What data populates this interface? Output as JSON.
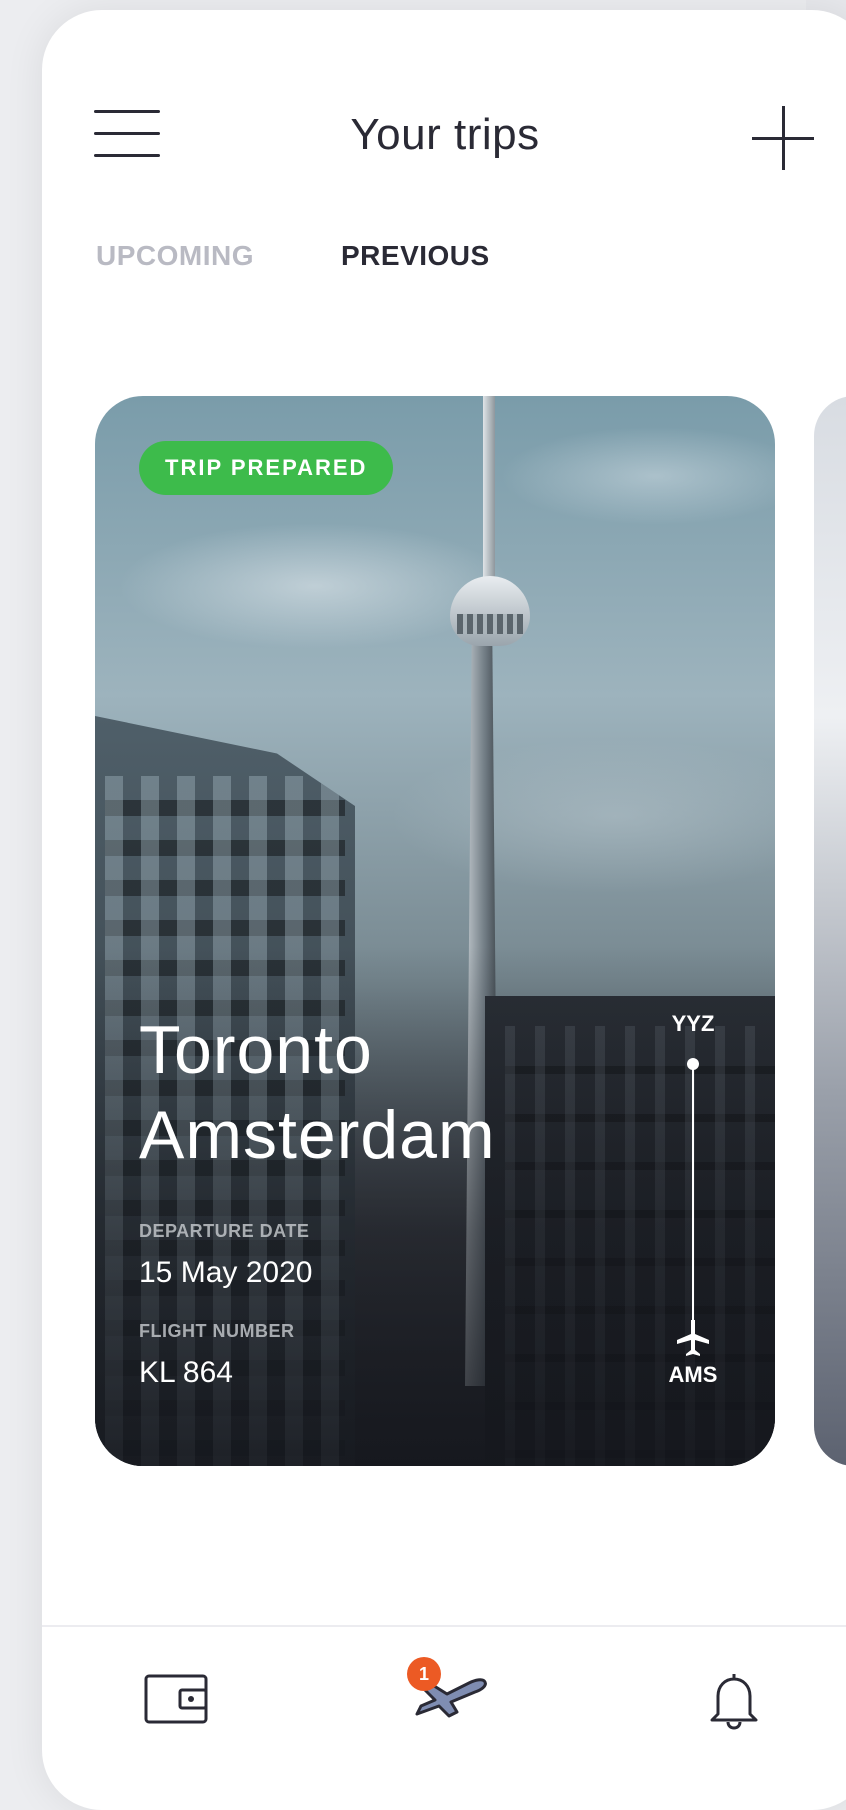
{
  "header": {
    "title": "Your trips"
  },
  "tabs": [
    {
      "label": "UPCOMING",
      "active": false
    },
    {
      "label": "PREVIOUS",
      "active": true
    }
  ],
  "trip_card": {
    "badge": "TRIP PREPARED",
    "badge_color": "#3dbb4b",
    "from_city": "Toronto",
    "to_city": "Amsterdam",
    "departure_label": "DEPARTURE DATE",
    "departure_value": "15 May 2020",
    "flight_label": "FLIGHT NUMBER",
    "flight_value": "KL 864",
    "from_code": "YYZ",
    "to_code": "AMS"
  },
  "bottom_nav": {
    "items": [
      {
        "icon": "wallet-icon"
      },
      {
        "icon": "airplane-icon",
        "badge_count": "1"
      },
      {
        "icon": "bell-icon"
      }
    ],
    "badge_color": "#ec5a24"
  }
}
